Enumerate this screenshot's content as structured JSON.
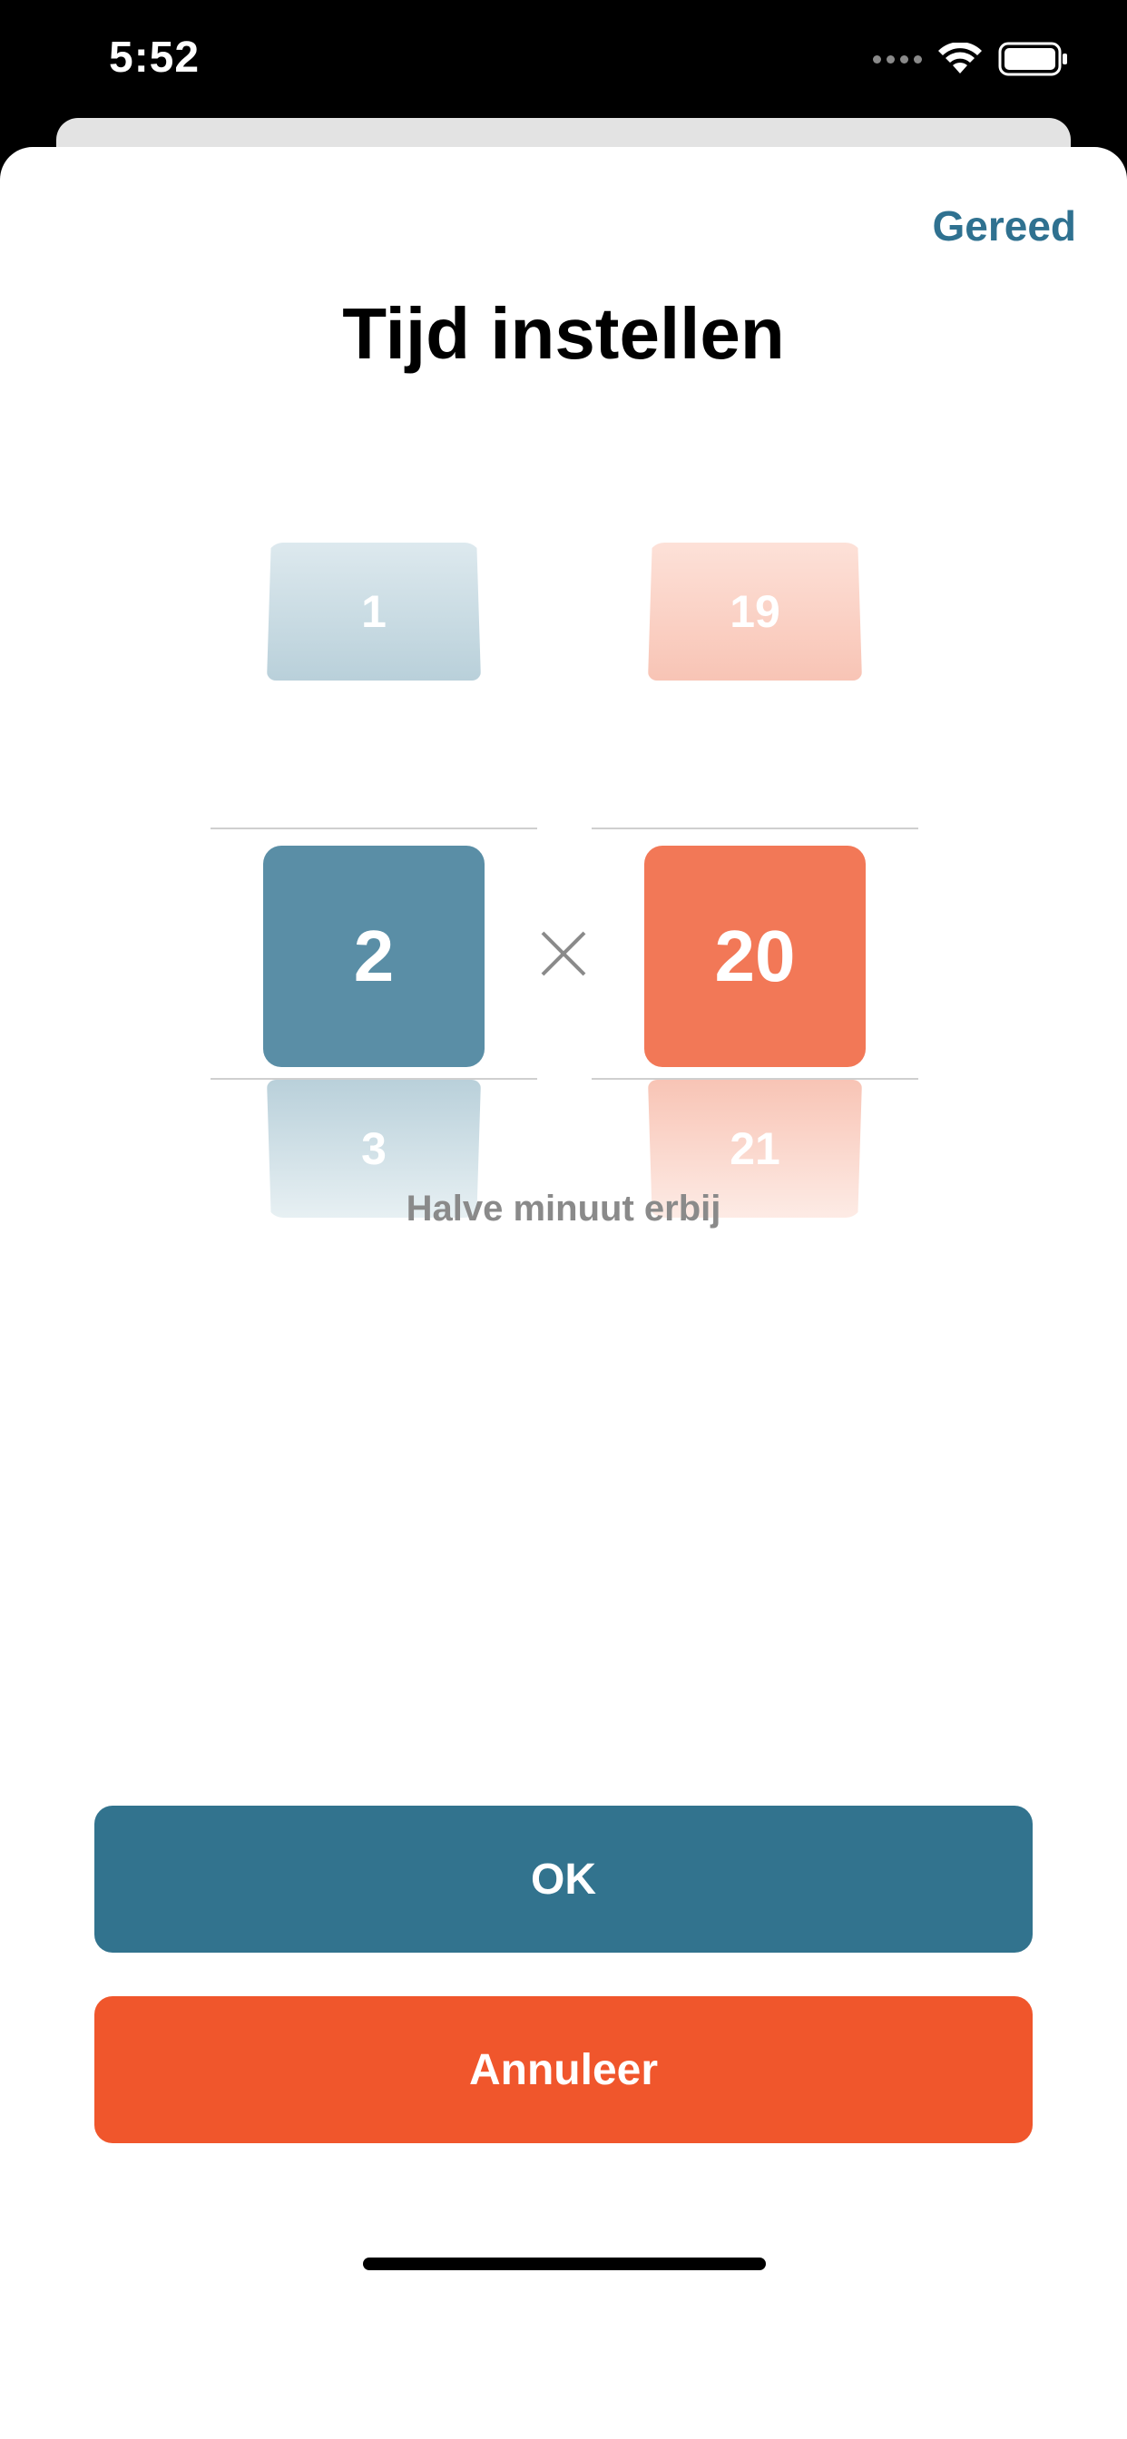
{
  "status_bar": {
    "time": "5:52"
  },
  "header": {
    "done_label": "Gereed",
    "title": "Tijd instellen"
  },
  "picker_left": {
    "prev": "1",
    "selected": "2",
    "next": "3"
  },
  "picker_right": {
    "prev": "19",
    "selected": "20",
    "next": "21"
  },
  "subtitle": "Halve minuut erbij",
  "buttons": {
    "ok_label": "OK",
    "cancel_label": "Annuleer"
  },
  "colors": {
    "accent_blue": "#32738e",
    "accent_orange": "#f0562c",
    "link_blue": "#2f7190"
  },
  "icons": {
    "multiply": "multiply-icon",
    "wifi": "wifi-icon",
    "battery": "battery-icon",
    "signal": "cellular-signal-icon"
  }
}
